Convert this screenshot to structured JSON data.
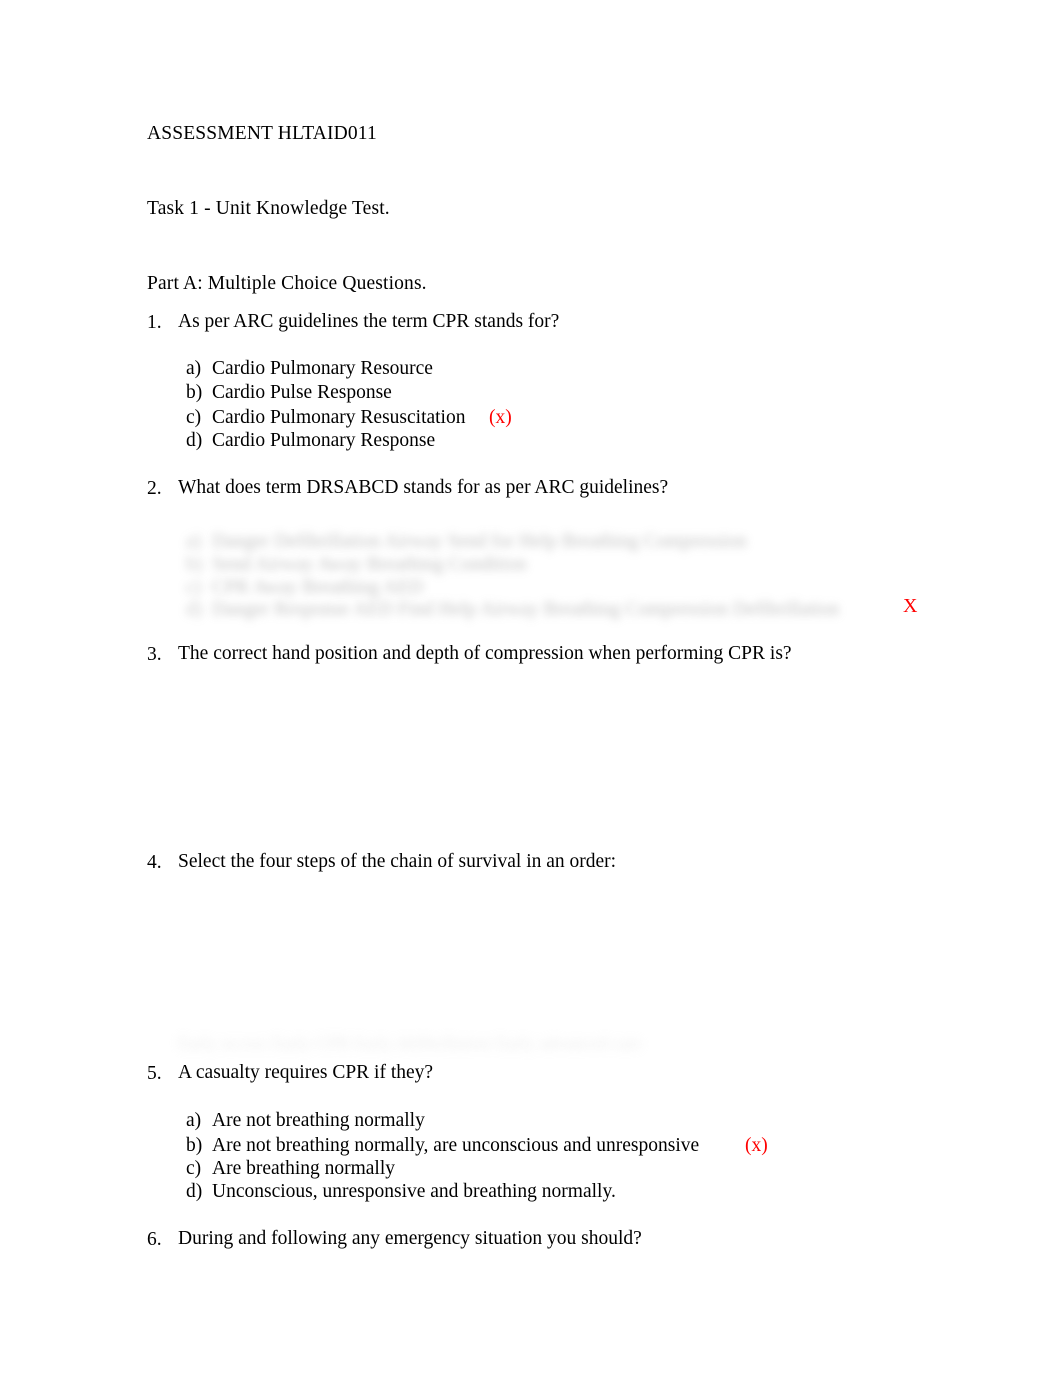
{
  "document": {
    "title": "ASSESSMENT HLTAID011",
    "task_line": "Task 1 - Unit Knowledge Test.",
    "part_line": "Part A: Multiple Choice Questions.",
    "answer_mark": "(x)",
    "cross_mark": "X",
    "mark_color": "#ff0000"
  },
  "questions": [
    {
      "number": "1.",
      "text": "As per ARC guidelines the term CPR stands for?",
      "options": [
        {
          "letter": "a)",
          "text": "Cardio Pulmonary Resource",
          "marked": false
        },
        {
          "letter": "b)",
          "text": "Cardio Pulse Response",
          "marked": false
        },
        {
          "letter": "c)",
          "text": "Cardio Pulmonary Resuscitation",
          "marked": true
        },
        {
          "letter": "d)",
          "text": "Cardio Pulmonary Response",
          "marked": false
        }
      ]
    },
    {
      "number": "2.",
      "text": "What does term DRSABCD stands for as per ARC guidelines?",
      "options_redacted": true,
      "redacted_options": [
        {
          "letter": "a)",
          "text": "Danger Defibrillation Airway Send for Help Breathing Compression"
        },
        {
          "letter": "b)",
          "text": "Send Airway Away Breathing Condition"
        },
        {
          "letter": "c)",
          "text": "CPR Away Breathing AED"
        },
        {
          "letter": "d)",
          "text": "Danger Response AED Find Help Airway Breathing Compression Defibrillation"
        }
      ],
      "cross_marked": true
    },
    {
      "number": "3.",
      "text": "The correct hand position and depth of compression when performing CPR is?",
      "options_erased": true,
      "redacted_options": []
    },
    {
      "number": "4.",
      "text": "Select the four steps of the chain of survival in an order:",
      "options_erased": true,
      "ghost_remnant": "Early access Early CPR Early defibrillation Early advanced care"
    },
    {
      "number": "5.",
      "text": "A casualty requires CPR if they?",
      "options": [
        {
          "letter": "a)",
          "text": "Are not breathing normally",
          "marked": false
        },
        {
          "letter": "b)",
          "text": "Are not breathing normally, are unconscious and unresponsive",
          "marked": true
        },
        {
          "letter": "c)",
          "text": "Are breathing normally",
          "marked": false
        },
        {
          "letter": "d)",
          "text": "Unconscious, unresponsive and breathing normally.",
          "marked": false
        }
      ]
    },
    {
      "number": "6.",
      "text": "During and following any emergency situation you should?",
      "options": []
    }
  ]
}
